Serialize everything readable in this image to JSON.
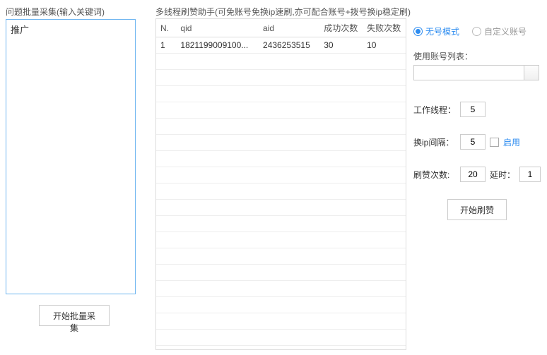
{
  "left": {
    "title": "问题批量采集(输入关键词)",
    "keyword": "推广",
    "start_button": "开始批量采集"
  },
  "right": {
    "title": "多线程刷赞助手(可免账号免换ip速刷,亦可配合账号+拨号换ip稳定刷)",
    "columns": {
      "n": "N.",
      "qid": "qid",
      "aid": "aid",
      "success": "成功次数",
      "fail": "失败次数"
    },
    "rows": [
      {
        "n": "1",
        "qid": "1821199009100...",
        "aid": "2436253515",
        "success": "30",
        "fail": "10"
      }
    ]
  },
  "settings": {
    "mode_none": "无号模式",
    "mode_custom": "自定义账号",
    "account_list_label": "使用账号列表：",
    "thread_label": "工作线程：",
    "thread_value": "5",
    "ip_interval_label": "换ip间隔：",
    "ip_interval_value": "5",
    "enable_label": "启用",
    "count_label": "刷赞次数:",
    "count_value": "20",
    "delay_label": "延时：",
    "delay_value": "1",
    "start_button": "开始刷赞"
  }
}
